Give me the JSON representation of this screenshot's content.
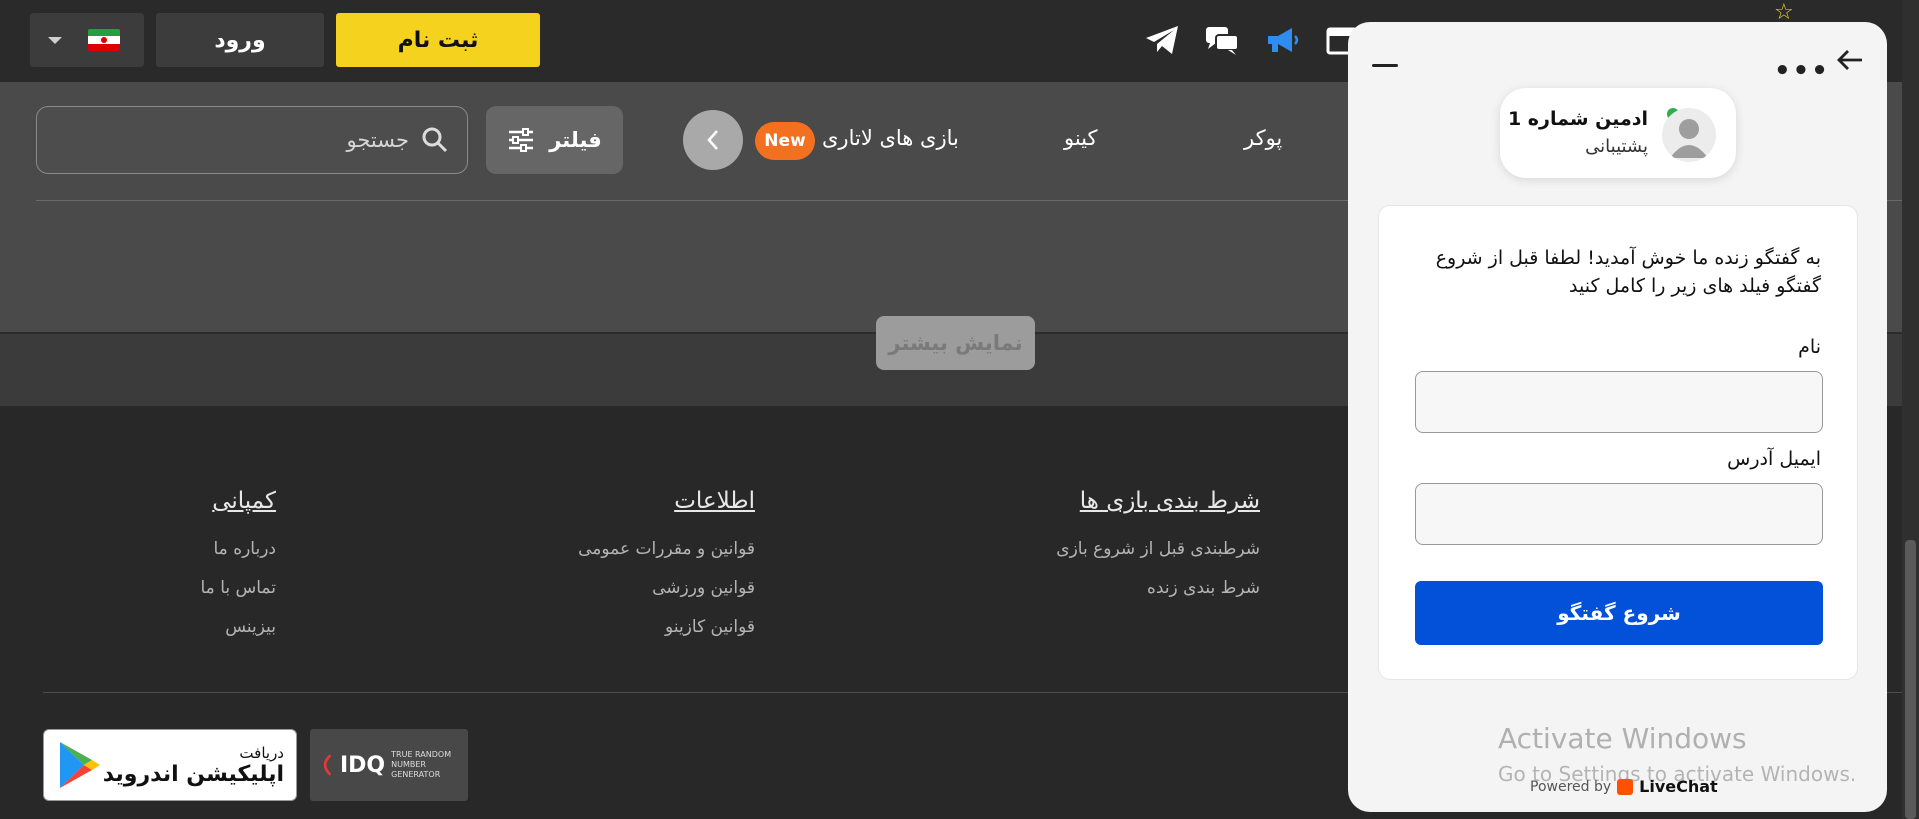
{
  "header": {
    "register_label": "ثبت نام",
    "login_label": "ورود",
    "language": "fa"
  },
  "nav": {
    "search_placeholder": "جستجو",
    "filter_label": "فیلتر",
    "new_badge": "New",
    "items": [
      {
        "label": "بازی های لاتاری"
      },
      {
        "label": "کینو"
      },
      {
        "label": "پوکر"
      }
    ],
    "show_more_label": "نمایش بیشتر"
  },
  "footer": {
    "columns": [
      {
        "title": "شرط بندی بازی ها",
        "links": [
          "شرطبندی قبل از شروع بازی",
          "شرط بندی زنده"
        ]
      },
      {
        "title": "اطلاعات",
        "links": [
          "قوانین و مقررات عمومی",
          "قوانین ورزشی",
          "قوانین کازینو"
        ]
      },
      {
        "title": "کمپانی",
        "links": [
          "درباره ما",
          "تماس با ما",
          "بیزینس"
        ]
      }
    ],
    "idq": {
      "logo": "IDQ",
      "line1": "TRUE RANDOM",
      "line2": "NUMBER GENERATOR"
    },
    "app": {
      "line1": "دریافت",
      "line2": "اپلیکیشن اندروید"
    }
  },
  "chat": {
    "agent_name": "ادمین شماره 1",
    "agent_role": "پشتیبانی",
    "welcome": "به گفتگو زنده ما خوش آمدید! لطفا قبل از شروع گفتگو فیلد های زیر را کامل کنید",
    "name_label": "نام",
    "email_label": "ایمیل آدرس",
    "start_label": "شروع گفتگو",
    "powered_by": "Powered by",
    "brand": "LiveChat"
  },
  "watermark": {
    "line1": "Activate Windows",
    "line2": "Go to Settings to activate Windows."
  },
  "colors": {
    "accent_yellow": "#f5d21e",
    "new_badge": "#f37021",
    "chat_button": "#0351d8",
    "online": "#2fae4d"
  }
}
